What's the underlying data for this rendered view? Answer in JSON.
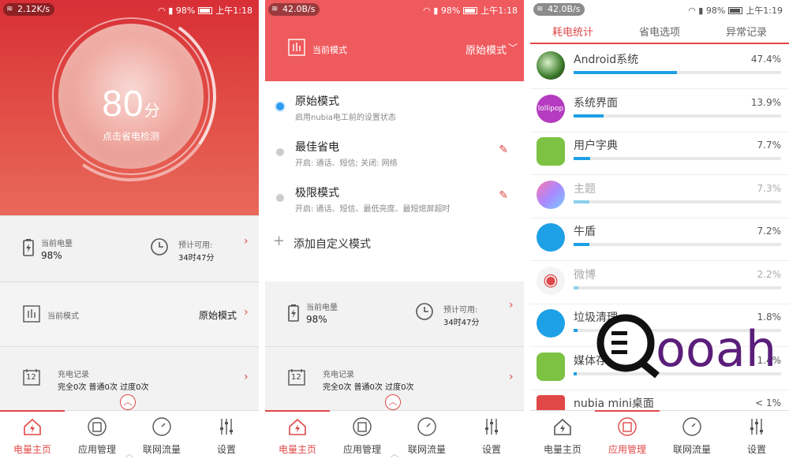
{
  "screen1": {
    "status": {
      "speed": "2.12K/s",
      "battery": "98%",
      "time": "上午1:18"
    },
    "hero": {
      "score": "80",
      "unit": "分",
      "hint": "点击省电检测"
    },
    "battery_card": {
      "label": "当前电量",
      "value": "98%",
      "remain_label": "预计可用:",
      "remain_value": "34时47分"
    },
    "mode_card": {
      "label": "当前模式",
      "value": "原始模式"
    },
    "charge_card": {
      "label": "充电记录",
      "value": "完全0次 普通0次 过度0次",
      "calendar_day": "12"
    }
  },
  "screen2": {
    "status": {
      "speed": "42.0B/s",
      "battery": "98%",
      "time": "上午1:18"
    },
    "mode_bar": {
      "label": "当前模式",
      "value": "原始模式"
    },
    "modes": [
      {
        "title": "原始模式",
        "desc": "启用nubia电工前的设置状态"
      },
      {
        "title": "最佳省电",
        "desc": "开启: 通话、短信; 关闭: 网络"
      },
      {
        "title": "极限模式",
        "desc": "开启: 通话、短信、最低亮度、最短熄屏超时"
      }
    ],
    "add_mode": "添加自定义模式",
    "battery_card": {
      "label": "当前电量",
      "value": "98%",
      "remain_label": "预计可用:",
      "remain_value": "34时47分"
    },
    "charge_card": {
      "label": "充电记录",
      "value": "完全0次 普通0次 过度0次",
      "calendar_day": "12"
    }
  },
  "screen3": {
    "status": {
      "speed": "42.0B/s",
      "battery": "98%",
      "time": "上午1:19"
    },
    "tabs": [
      "耗电统计",
      "省电选项",
      "异常记录"
    ],
    "apps": [
      {
        "name": "Android系统",
        "pct": "47.4%",
        "level": 47.4
      },
      {
        "name": "系统界面",
        "pct": "13.9%",
        "level": 13.9
      },
      {
        "name": "用户字典",
        "pct": "7.7%",
        "level": 7.7
      },
      {
        "name": "主题",
        "pct": "7.3%",
        "level": 7.3
      },
      {
        "name": "牛盾",
        "pct": "7.2%",
        "level": 7.2
      },
      {
        "name": "微博",
        "pct": "2.2%",
        "level": 2.2
      },
      {
        "name": "垃圾清理",
        "pct": "1.8%",
        "level": 1.8
      },
      {
        "name": "媒体存储",
        "pct": "1.4%",
        "level": 1.4
      },
      {
        "name": "nubia mini桌面",
        "pct": "< 1%",
        "level": 0.5
      }
    ],
    "lollipop_text": "lollipop"
  },
  "tabbar": [
    "电量主页",
    "应用管理",
    "联网流量",
    "设置"
  ],
  "watermark": {
    "text": "ooah"
  },
  "colors": {
    "accent": "#e04848",
    "bar": "#1ea0e6",
    "hero": "#d82f36"
  }
}
